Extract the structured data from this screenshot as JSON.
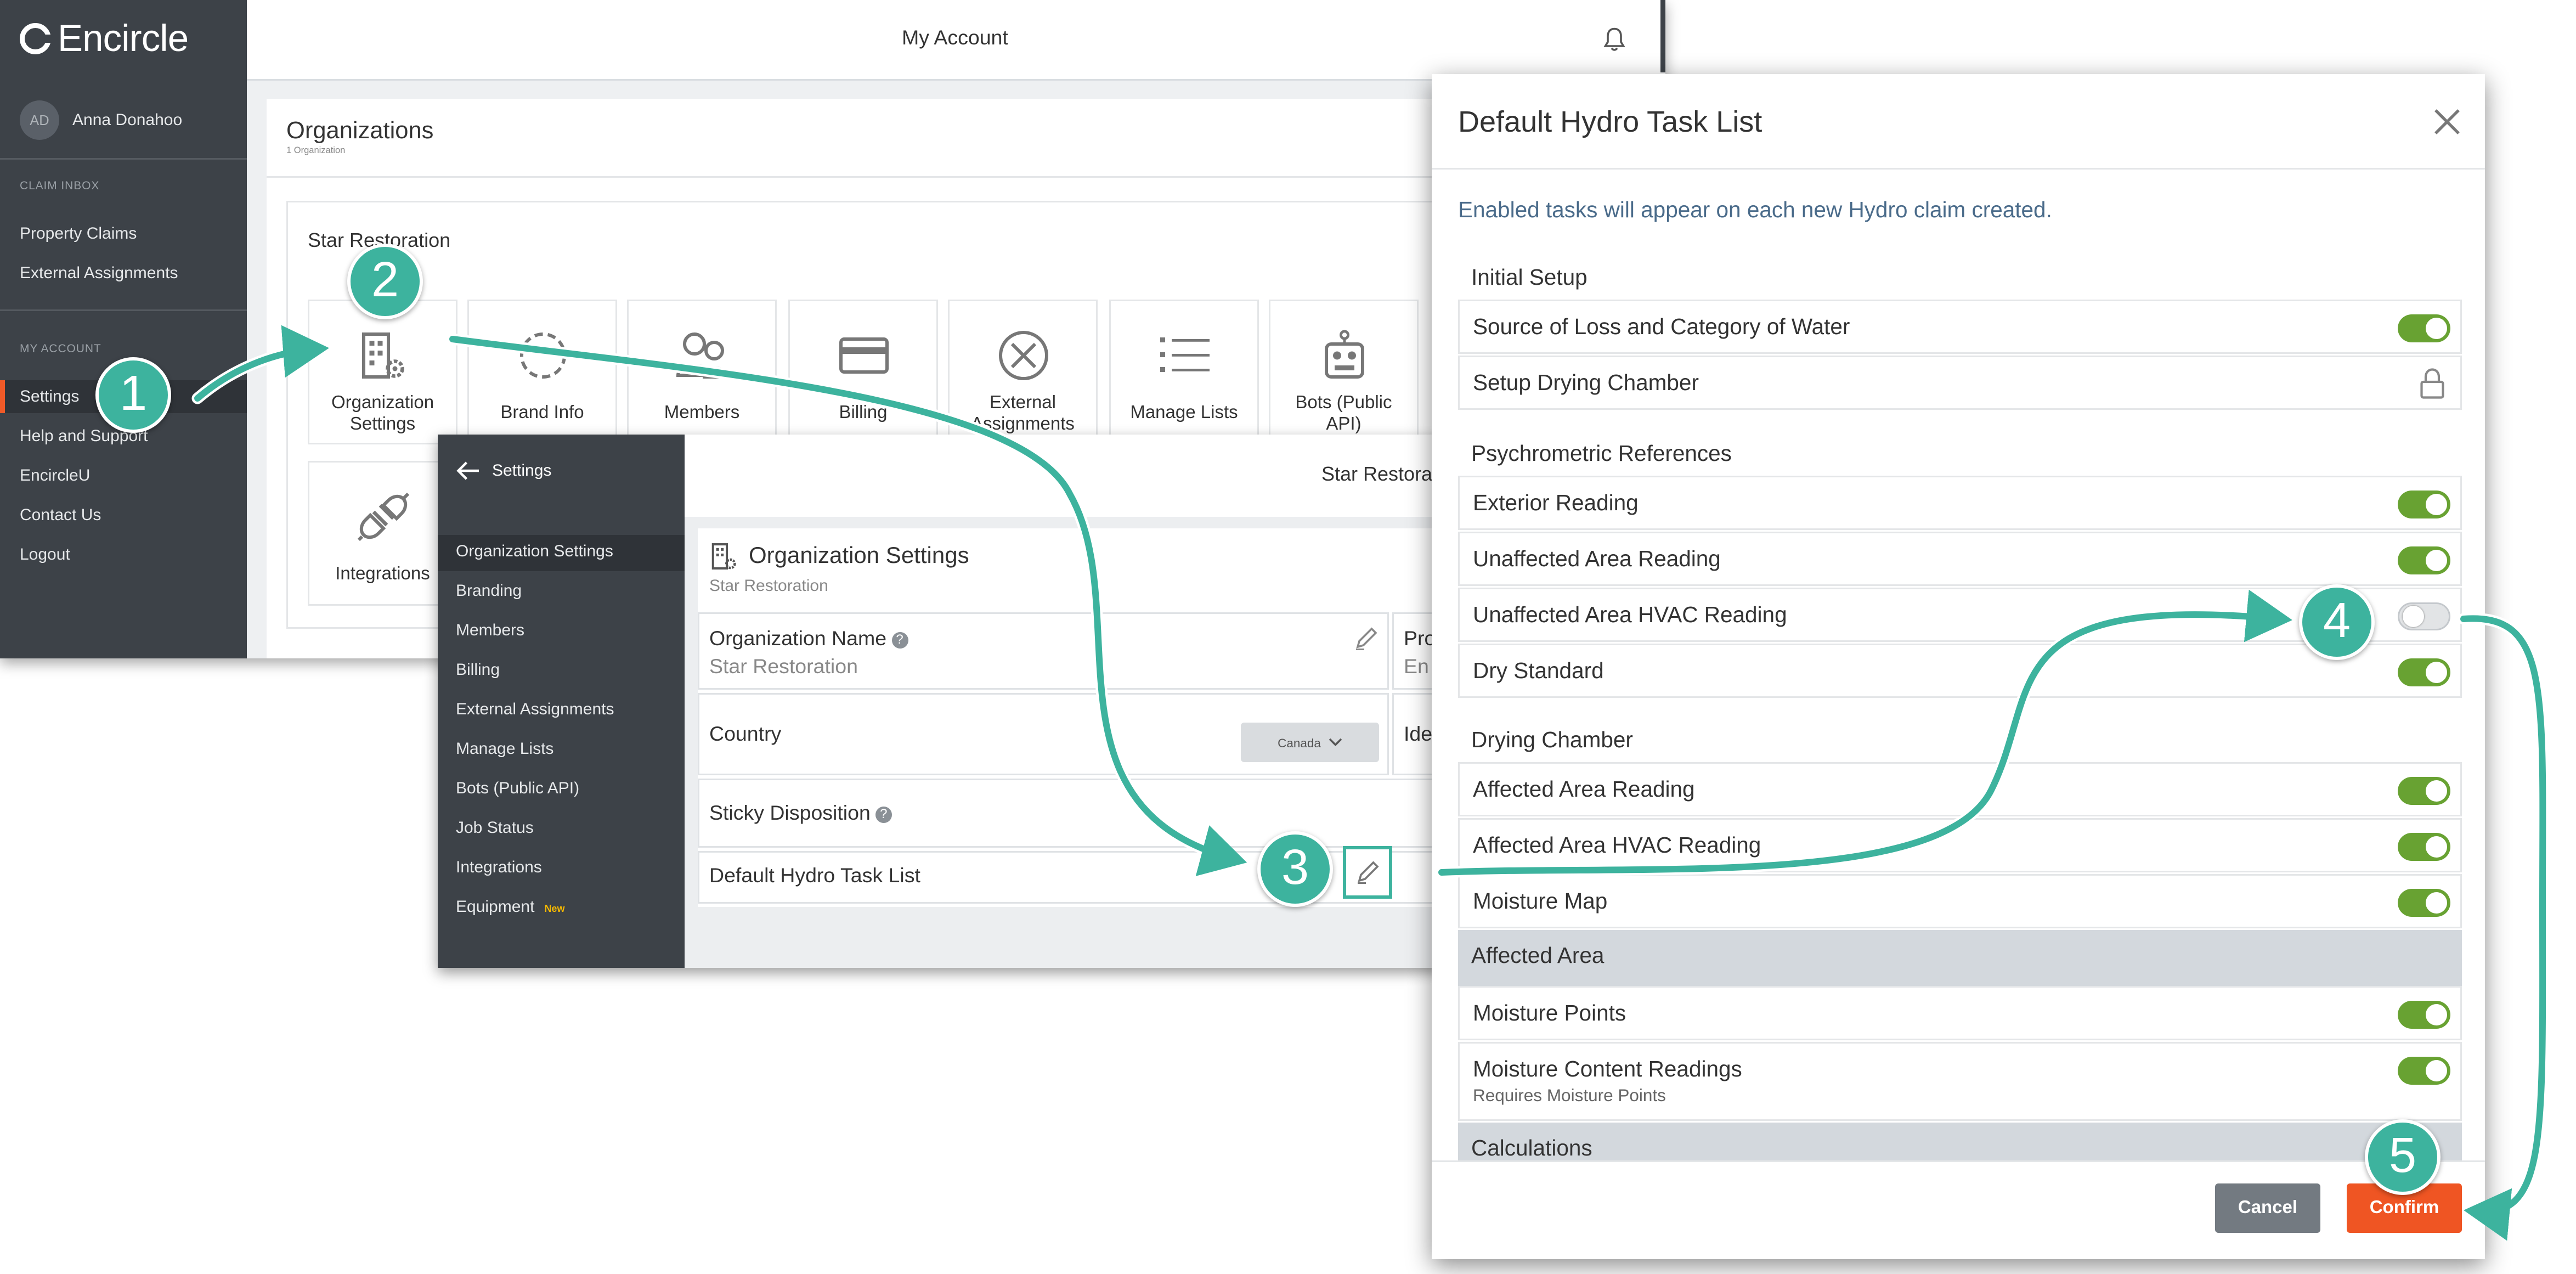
{
  "app": {
    "brand": "Encircle",
    "user": {
      "initials": "AD",
      "name": "Anna Donahoo"
    },
    "sidebar": {
      "sections": [
        {
          "heading": "CLAIM INBOX",
          "items": [
            "Property Claims",
            "External Assignments"
          ]
        },
        {
          "heading": "MY ACCOUNT",
          "items": [
            "Settings",
            "Help and Support",
            "EncircleU",
            "Contact Us",
            "Logout"
          ]
        }
      ],
      "active": "Settings"
    },
    "topbar": {
      "title": "My Account"
    },
    "organizations": {
      "title": "Organizations",
      "subtitle": "1 Organization",
      "org_name": "Star Restoration",
      "tiles": [
        {
          "label": "Organization Settings",
          "icon": "building-gear-icon"
        },
        {
          "label": "Brand Info",
          "icon": "dashed-circle-icon"
        },
        {
          "label": "Members",
          "icon": "members-icon"
        },
        {
          "label": "Billing",
          "icon": "credit-card-icon"
        },
        {
          "label": "External Assignments",
          "icon": "circle-x-icon"
        },
        {
          "label": "Manage Lists",
          "icon": "list-icon"
        },
        {
          "label": "Bots (Public API)",
          "icon": "robot-icon"
        },
        {
          "label": "Integrations",
          "icon": "plug-icon"
        }
      ]
    }
  },
  "settings": {
    "back_label": "Settings",
    "nav": [
      "Organization Settings",
      "Branding",
      "Members",
      "Billing",
      "External Assignments",
      "Manage Lists",
      "Bots (Public API)",
      "Job Status",
      "Integrations",
      "Equipment"
    ],
    "new_badge": "New",
    "top_org": "Star Restoration",
    "panel": {
      "title": "Organization Settings",
      "subtitle": "Star Restoration",
      "org_name_label": "Organization Name",
      "org_name_value": "Star Restoration",
      "pro_label": "Pro",
      "pro_value": "En",
      "country_label": "Country",
      "country_value": "Canada",
      "ide_label": "Ide",
      "sticky_label": "Sticky Disposition",
      "hydro_label": "Default Hydro Task List"
    }
  },
  "modal": {
    "title": "Default Hydro Task List",
    "description": "Enabled tasks will appear on each new Hydro claim created.",
    "sections": {
      "initial_setup": "Initial Setup",
      "psychrometric": "Psychrometric References",
      "drying_chamber": "Drying Chamber",
      "affected_area": "Affected Area",
      "calculations": "Calculations"
    },
    "tasks": {
      "source_of_loss": {
        "label": "Source of Loss and Category of Water",
        "enabled": true
      },
      "setup_drying": {
        "label": "Setup Drying Chamber",
        "locked": true
      },
      "exterior": {
        "label": "Exterior Reading",
        "enabled": true
      },
      "unaffected": {
        "label": "Unaffected Area Reading",
        "enabled": true
      },
      "unaffected_hvac": {
        "label": "Unaffected Area HVAC Reading",
        "enabled": false
      },
      "dry_standard": {
        "label": "Dry Standard",
        "enabled": true
      },
      "affected_reading": {
        "label": "Affected Area Reading",
        "enabled": true
      },
      "affected_hvac": {
        "label": "Affected Area HVAC Reading",
        "enabled": true
      },
      "moisture_map": {
        "label": "Moisture Map",
        "enabled": true
      },
      "moisture_points": {
        "label": "Moisture Points",
        "enabled": true
      },
      "moisture_content": {
        "label": "Moisture Content Readings",
        "sublabel": "Requires Moisture Points",
        "enabled": true
      }
    },
    "cancel_label": "Cancel",
    "confirm_label": "Confirm"
  },
  "steps": [
    "1",
    "2",
    "3",
    "4",
    "5"
  ],
  "colors": {
    "accent_orange": "#ef5523",
    "toggle_green": "#68a232",
    "step_teal": "#3db39e",
    "sidebar_dark": "#3d4248"
  }
}
